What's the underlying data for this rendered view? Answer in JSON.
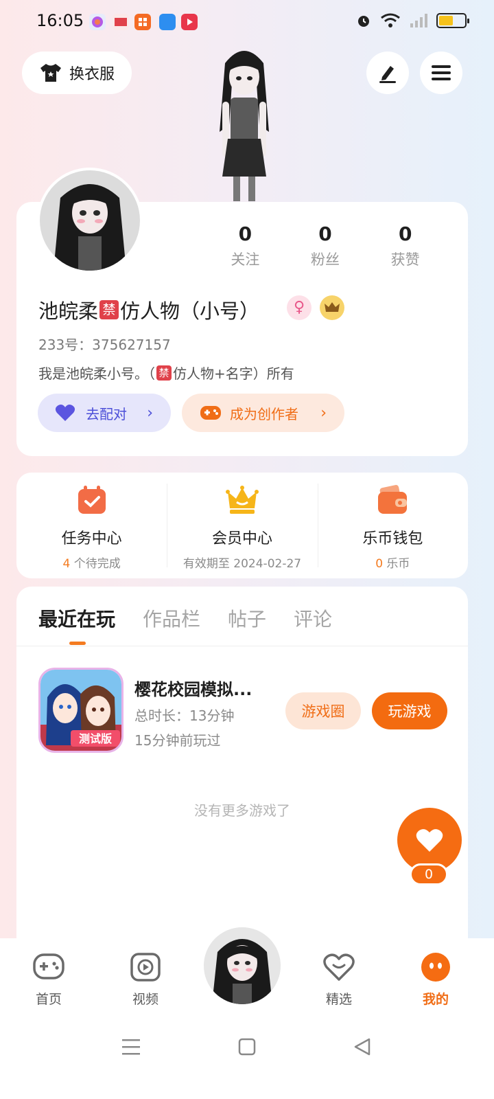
{
  "status_bar": {
    "time": "16:05",
    "app_icon_colors": [
      "#e7ecfb",
      "#fbe9e9",
      "#f46a24",
      "#2d8ef0",
      "#e8364b"
    ],
    "battery_level": 0.55
  },
  "header": {
    "outfit_label": "换衣服",
    "edit_icon": "pen-icon",
    "menu_icon": "menu-icon"
  },
  "profile": {
    "stats": [
      {
        "value": "0",
        "label": "关注"
      },
      {
        "value": "0",
        "label": "粉丝"
      },
      {
        "value": "0",
        "label": "获赞"
      }
    ],
    "nickname_part1": "池皖柔",
    "nickname_forbid": "禁",
    "nickname_part2": "仿人物（小号）",
    "gender_symbol": "♀",
    "uid": "233号：375627157",
    "bio_part1": "我是池皖柔小号。（",
    "bio_forbid": "禁",
    "bio_part2": "仿人物+名字）所有",
    "pair_label": "去配对",
    "creator_label": "成为创作者",
    "chevron": "›"
  },
  "services": [
    {
      "title": "任务中心",
      "highlight": "4",
      "sub": " 个待完成",
      "icon": "calendar-check-icon"
    },
    {
      "title": "会员中心",
      "highlight": "",
      "sub": "有效期至 2024-02-27",
      "icon": "crown-icon"
    },
    {
      "title": "乐币钱包",
      "highlight": "0",
      "sub": " 乐币",
      "icon": "wallet-icon"
    }
  ],
  "tabs": [
    "最近在玩",
    "作品栏",
    "帖子",
    "评论"
  ],
  "game": {
    "title": "樱花校园模拟...",
    "duration": "总时长：13分钟",
    "last_played": "15分钟前玩过",
    "icon_text": "测试版",
    "circle_label": "游戏圈",
    "play_label": "玩游戏"
  },
  "no_more": "没有更多游戏了",
  "fab": {
    "count": "0"
  },
  "bottom_nav": [
    {
      "label": "首页",
      "icon": "gamepad-icon"
    },
    {
      "label": "视频",
      "icon": "video-play-icon"
    },
    {
      "label": "精选",
      "icon": "heart-chat-icon"
    },
    {
      "label": "我的",
      "icon": "profile-face-icon"
    }
  ],
  "colors": {
    "accent": "#f47b20",
    "pair_text": "#4c4fd8",
    "forbid": "#e0414a"
  }
}
